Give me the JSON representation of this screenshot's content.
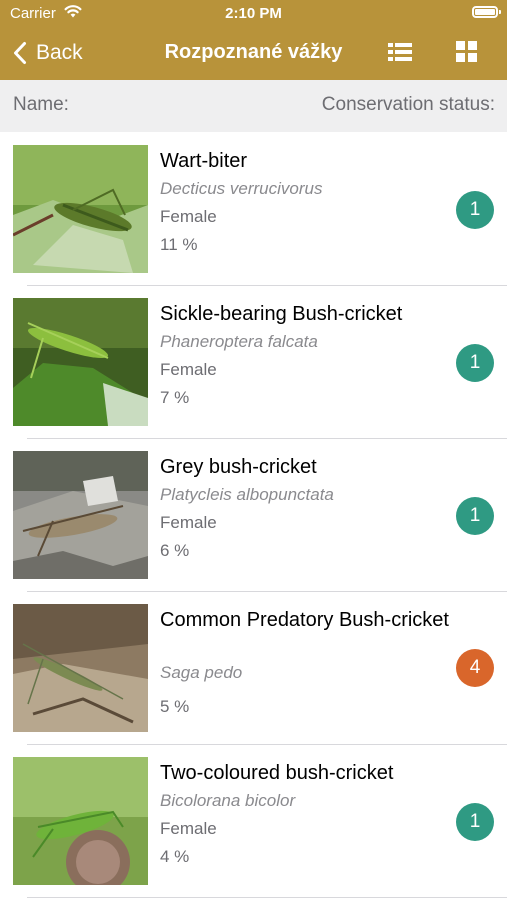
{
  "status_bar": {
    "carrier": "Carrier",
    "time": "2:10 PM"
  },
  "nav": {
    "back_label": "Back",
    "title": "Rozpoznané vážky"
  },
  "columns": {
    "name_label": "Name:",
    "status_label": "Conservation status:"
  },
  "colors": {
    "header": "#b8933a",
    "badge_green": "#2f9a83",
    "badge_orange": "#d9662b"
  },
  "rows": [
    {
      "name": "Wart-biter",
      "latin": "Decticus verrucivorus",
      "sex": "Female",
      "percent": "11 %",
      "status": "1",
      "status_color": "green",
      "image": "grasshopper-on-leaf"
    },
    {
      "name": "Sickle-bearing Bush-cricket",
      "latin": "Phaneroptera falcata",
      "sex": "Female",
      "percent": "7 %",
      "status": "1",
      "status_color": "green",
      "image": "green-cricket-on-leaf"
    },
    {
      "name": "Grey bush-cricket",
      "latin": "Platycleis albopunctata",
      "sex": "Female",
      "percent": "6 %",
      "status": "1",
      "status_color": "green",
      "image": "grey-cricket-on-rock"
    },
    {
      "name": "Common Predatory Bush-cricket",
      "latin": "Saga pedo",
      "sex": "",
      "percent": "5 %",
      "status": "4",
      "status_color": "orange",
      "image": "cricket-on-ground"
    },
    {
      "name": "Two-coloured bush-cricket",
      "latin": "Bicolorana bicolor",
      "sex": "Female",
      "percent": "4 %",
      "status": "1",
      "status_color": "green",
      "image": "cricket-on-flower"
    }
  ]
}
